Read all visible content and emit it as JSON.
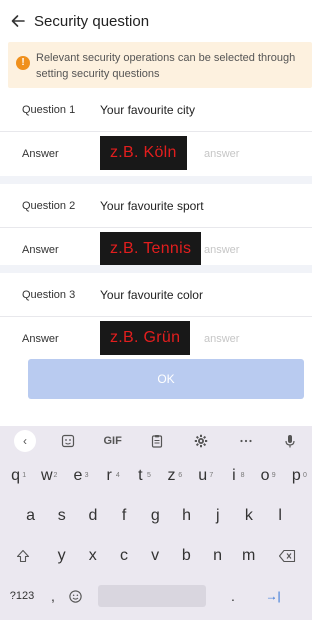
{
  "header": {
    "back_icon": "arrow-left-icon",
    "title": "Security question"
  },
  "notice": {
    "icon": "warning-circle-icon",
    "icon_glyph": "!",
    "text": "Relevant security operations can be selected through setting security questions"
  },
  "questions": [
    {
      "label": "Question 1",
      "text": "Your favourite city",
      "answer_label": "Answer",
      "answer_placeholder": "answer",
      "overlay_text": "z.B. Köln"
    },
    {
      "label": "Question 2",
      "text": "Your favourite sport",
      "answer_label": "Answer",
      "answer_placeholder": "answer",
      "overlay_text": "z.B. Tennis"
    },
    {
      "label": "Question 3",
      "text": "Your favourite color",
      "answer_label": "Answer",
      "answer_placeholder": "answer",
      "overlay_text": "z.B. Grün"
    }
  ],
  "ok_button": {
    "label": "OK",
    "color": "#b9cbf0"
  },
  "keyboard": {
    "toolbar": {
      "back": "‹",
      "gif": "GIF",
      "items": [
        "chevron-left-icon",
        "sticker-icon",
        "gif-icon",
        "clipboard-icon",
        "gear-icon",
        "more-dots-icon",
        "microphone-icon"
      ]
    },
    "row1": [
      {
        "k": "q",
        "h": "1"
      },
      {
        "k": "w",
        "h": "2"
      },
      {
        "k": "e",
        "h": "3"
      },
      {
        "k": "r",
        "h": "4"
      },
      {
        "k": "t",
        "h": "5"
      },
      {
        "k": "z",
        "h": "6"
      },
      {
        "k": "u",
        "h": "7"
      },
      {
        "k": "i",
        "h": "8"
      },
      {
        "k": "o",
        "h": "9"
      },
      {
        "k": "p",
        "h": "0"
      }
    ],
    "row2": [
      "a",
      "s",
      "d",
      "f",
      "g",
      "h",
      "j",
      "k",
      "l"
    ],
    "row3": [
      "y",
      "x",
      "c",
      "v",
      "b",
      "n",
      "m"
    ],
    "row4": {
      "sym": "?123",
      "comma": ",",
      "period": ".",
      "enter": "→|"
    }
  }
}
